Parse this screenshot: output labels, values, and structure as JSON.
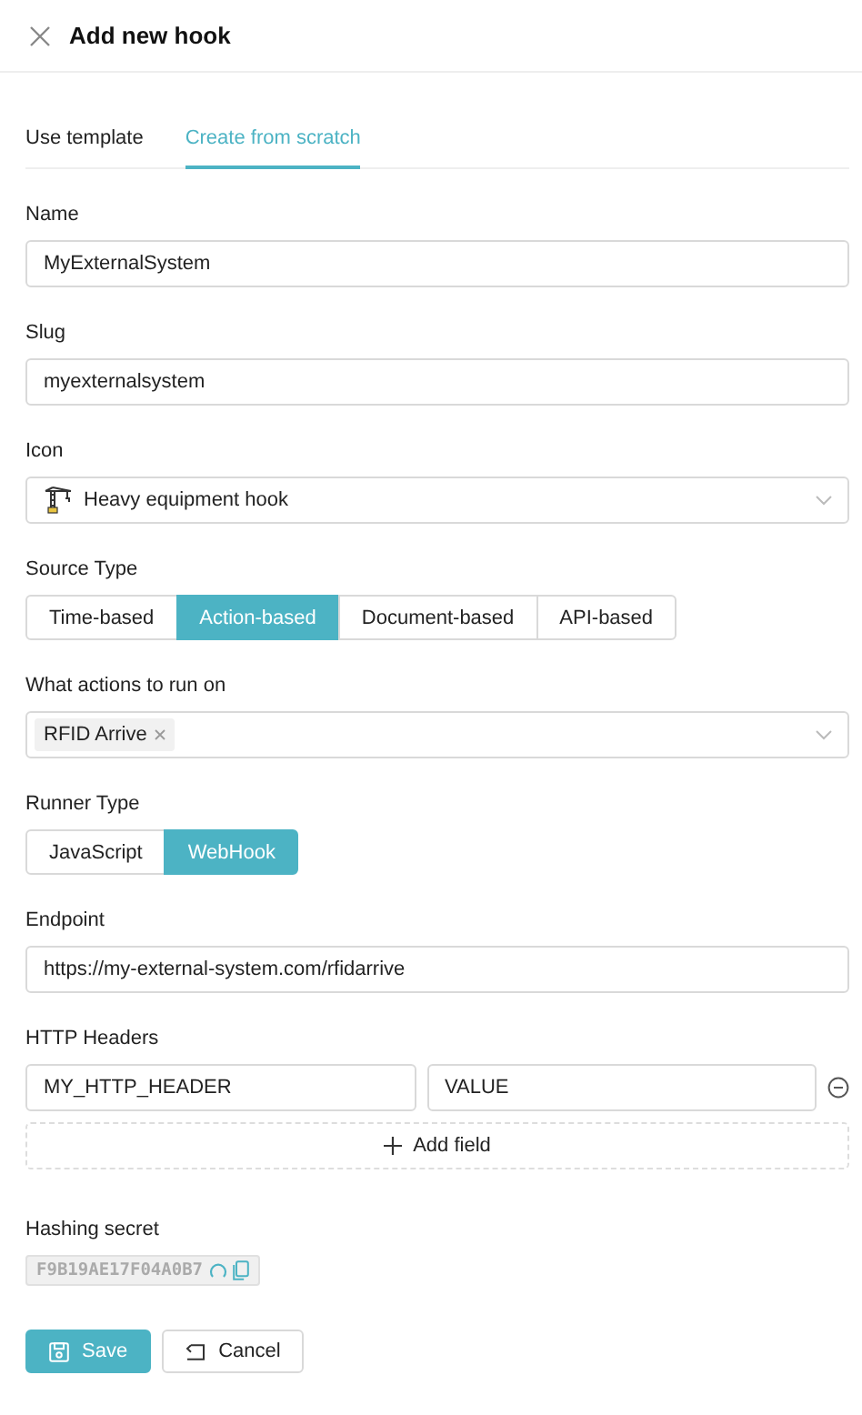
{
  "header": {
    "title": "Add new hook"
  },
  "tabs": [
    {
      "label": "Use template",
      "selected": false
    },
    {
      "label": "Create from scratch",
      "selected": true
    }
  ],
  "fields": [
    {
      "kind": "text",
      "label": "Name",
      "value": "MyExternalSystem"
    },
    {
      "kind": "text",
      "label": "Slug",
      "value": "myexternalsystem"
    },
    {
      "kind": "icon-select",
      "label": "Icon",
      "value": "Heavy equipment hook"
    },
    {
      "kind": "segmented",
      "label": "Source Type",
      "options": [
        {
          "label": "Time-based",
          "selected": false
        },
        {
          "label": "Action-based",
          "selected": true
        },
        {
          "label": "Document-based",
          "selected": false
        },
        {
          "label": "API-based",
          "selected": false
        }
      ]
    },
    {
      "kind": "tags",
      "label": "What actions to run on",
      "tags": [
        "RFID Arrive"
      ]
    },
    {
      "kind": "segmented",
      "label": "Runner Type",
      "options": [
        {
          "label": "JavaScript",
          "selected": false
        },
        {
          "label": "WebHook",
          "selected": true
        }
      ]
    },
    {
      "kind": "text",
      "label": "Endpoint",
      "value": "https://my-external-system.com/rfidarrive"
    },
    {
      "kind": "headers",
      "label": "HTTP Headers",
      "rows": [
        {
          "key": "MY_HTTP_HEADER",
          "value": "VALUE"
        }
      ],
      "add_label": "Add field"
    },
    {
      "kind": "secret",
      "label": "Hashing secret",
      "value": "F9B19AE17F04A0B7"
    }
  ],
  "buttons": [
    {
      "kind": "primary",
      "label": "Save"
    },
    {
      "kind": "default",
      "label": "Cancel"
    }
  ]
}
